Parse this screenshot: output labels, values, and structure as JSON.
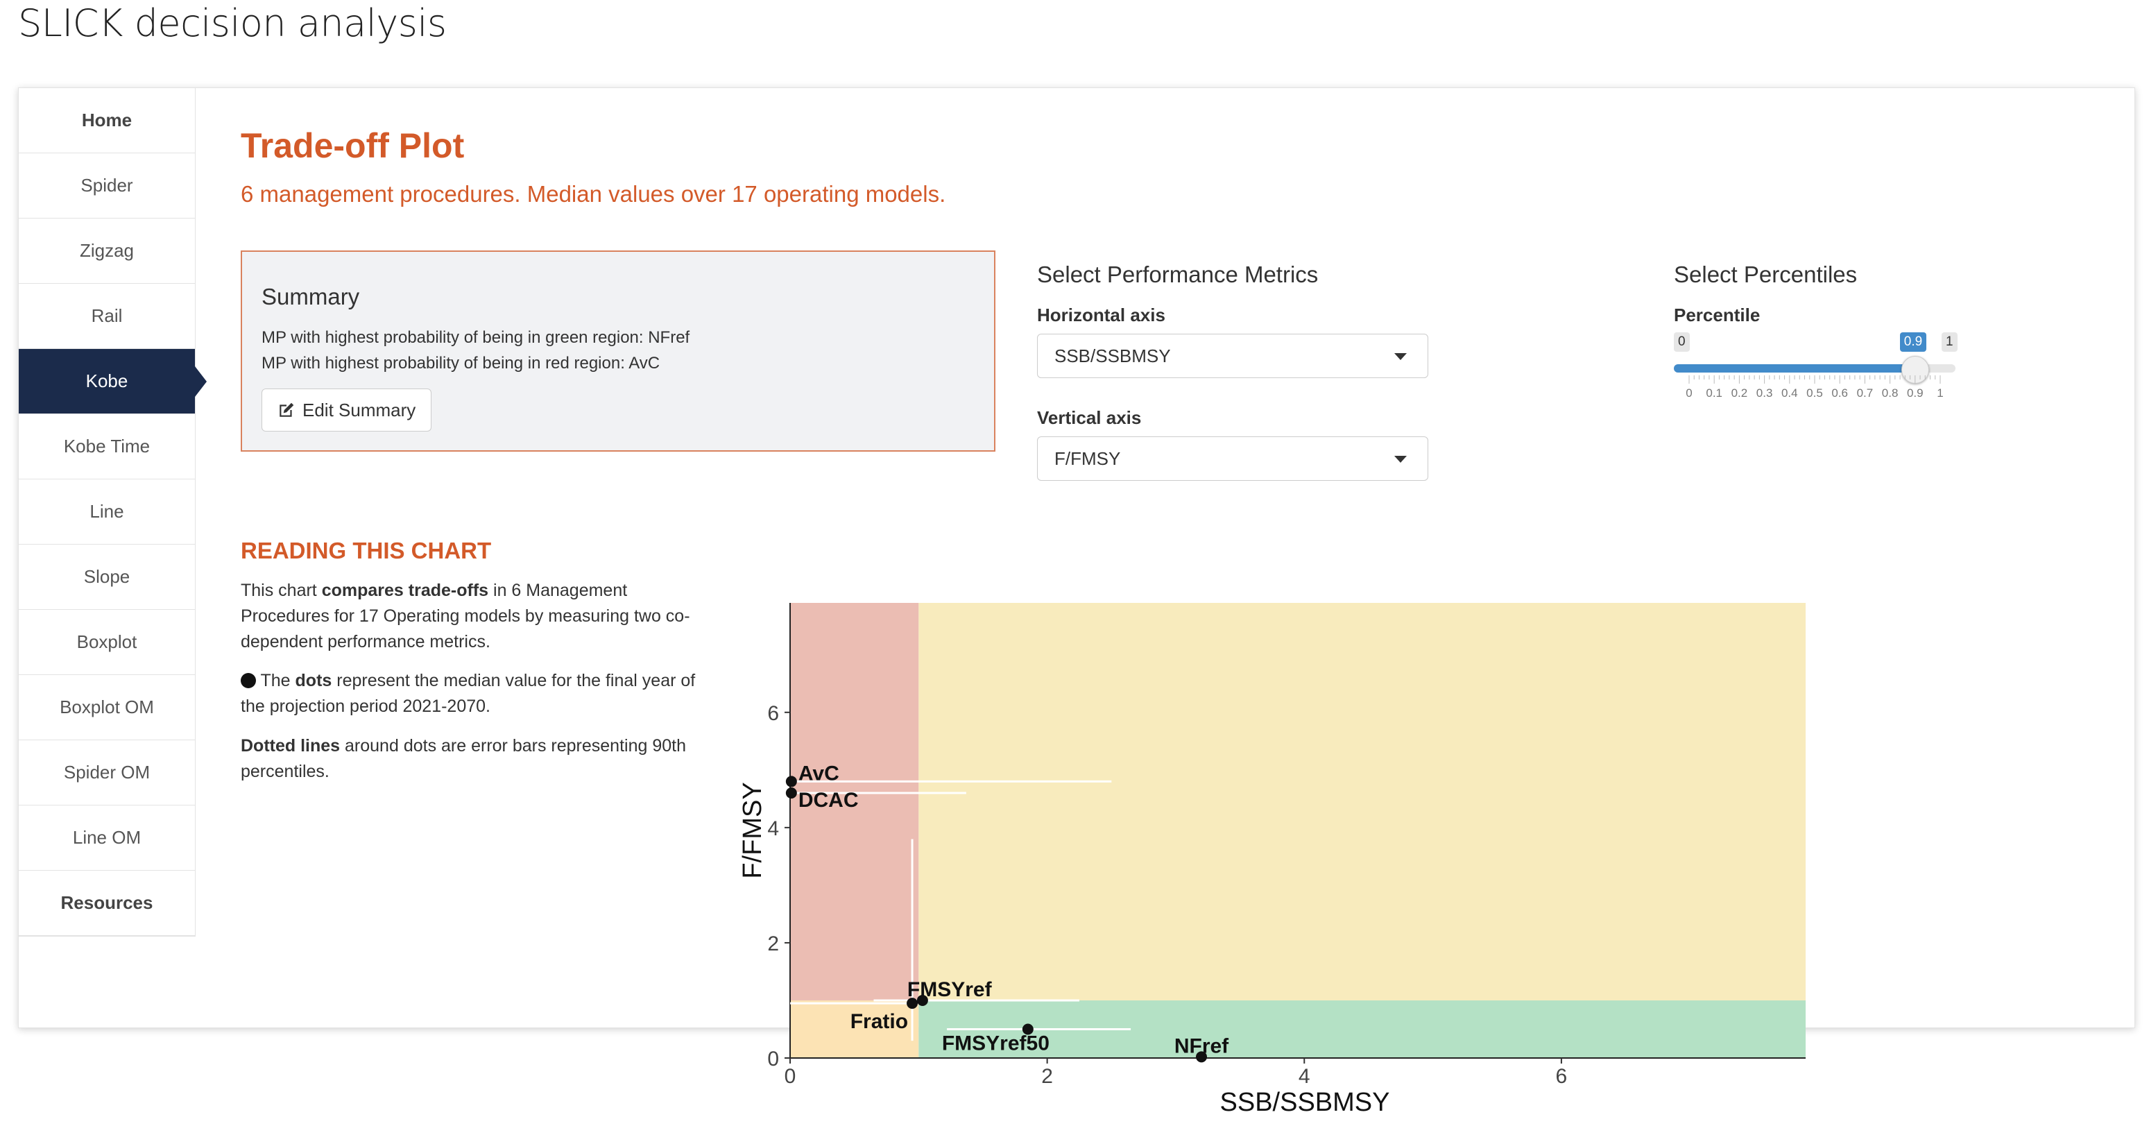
{
  "app_title": "SLICK decision analysis",
  "sidebar": {
    "items": [
      {
        "label": "Home",
        "bold": true
      },
      {
        "label": "Spider"
      },
      {
        "label": "Zigzag"
      },
      {
        "label": "Rail"
      },
      {
        "label": "Kobe",
        "active": true
      },
      {
        "label": "Kobe Time"
      },
      {
        "label": "Line"
      },
      {
        "label": "Slope"
      },
      {
        "label": "Boxplot"
      },
      {
        "label": "Boxplot OM"
      },
      {
        "label": "Spider OM"
      },
      {
        "label": "Line OM"
      },
      {
        "label": "Resources",
        "bold": true
      }
    ]
  },
  "main": {
    "title": "Trade-off Plot",
    "subtitle": "6 management procedures. Median values over 17 operating models."
  },
  "summary": {
    "heading": "Summary",
    "line1": "MP with highest probability of being in green region: NFref",
    "line2": "MP with highest probability of being in red region: AvC",
    "edit_button": "Edit Summary",
    "edit_icon": "edit-icon"
  },
  "metrics": {
    "heading": "Select Performance Metrics",
    "horizontal_label": "Horizontal axis",
    "horizontal_value": "SSB/SSBMSY",
    "vertical_label": "Vertical axis",
    "vertical_value": "F/FMSY"
  },
  "percentiles": {
    "heading": "Select Percentiles",
    "label": "Percentile",
    "min": "0",
    "max": "1",
    "value": "0.9",
    "value_fraction": 0.9,
    "ticks": [
      "0",
      "0.1",
      "0.2",
      "0.3",
      "0.4",
      "0.5",
      "0.6",
      "0.7",
      "0.8",
      "0.9",
      "1"
    ]
  },
  "reading": {
    "heading": "READING THIS CHART",
    "p1_a": "This chart ",
    "p1_b": "compares trade-offs",
    "p1_c": " in 6 Management Procedures for 17 Operating models by measuring two co-dependent performance metrics.",
    "p2_a": " The ",
    "p2_b": "dots",
    "p2_c": " represent the median value for the final year of the projection period 2021-2070.",
    "p3_a": "Dotted lines",
    "p3_b": " around dots are error bars representing 90th percentiles."
  },
  "chart_data": {
    "type": "scatter",
    "xlabel": "SSB/SSBMSY",
    "ylabel": "F/FMSY",
    "xlim": [
      0,
      7.9
    ],
    "ylim": [
      0,
      7.9
    ],
    "xticks": [
      0,
      2,
      4,
      6
    ],
    "yticks": [
      0,
      2,
      4,
      6
    ],
    "regions": {
      "red": "#ebbdb3",
      "yellow": "#f8ebbd",
      "orange": "#fce3b4",
      "green": "#b4e1c5"
    },
    "points": [
      {
        "label": "AvC",
        "x": 0.01,
        "y": 4.8,
        "xerr": [
          0.0,
          2.5
        ],
        "yerr": [
          4.8,
          4.8
        ]
      },
      {
        "label": "DCAC",
        "x": 0.01,
        "y": 4.6,
        "xerr": [
          0.0,
          1.37
        ],
        "yerr": [
          4.6,
          4.6
        ]
      },
      {
        "label": "FMSYref",
        "x": 1.03,
        "y": 1.0,
        "xerr": [
          0.65,
          2.25
        ],
        "yerr": [
          1.0,
          1.0
        ]
      },
      {
        "label": "Fratio",
        "x": 0.95,
        "y": 0.95,
        "xerr": [
          0.0,
          1.0
        ],
        "yerr": [
          0.3,
          3.8
        ]
      },
      {
        "label": "FMSYref50",
        "x": 1.85,
        "y": 0.5,
        "xerr": [
          1.22,
          2.65
        ],
        "yerr": [
          0.5,
          0.5
        ]
      },
      {
        "label": "NFref",
        "x": 3.2,
        "y": 0.02,
        "xerr": [
          3.2,
          3.2
        ],
        "yerr": [
          0.0,
          0.02
        ]
      }
    ]
  }
}
